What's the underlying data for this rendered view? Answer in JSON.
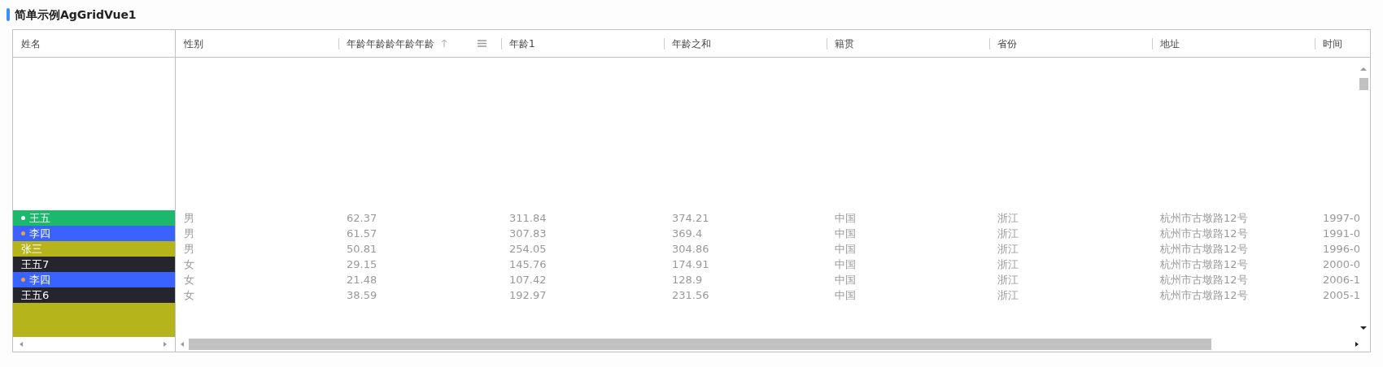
{
  "title": "简单示例AgGridVue1",
  "pinned_column": {
    "label": "姓名"
  },
  "columns": [
    {
      "label": "性别"
    },
    {
      "label": "年龄年龄龄年龄年龄",
      "sorted": true,
      "menu": true
    },
    {
      "label": "年龄1"
    },
    {
      "label": "年龄之和"
    },
    {
      "label": "籍贯"
    },
    {
      "label": "省份"
    },
    {
      "label": "地址"
    },
    {
      "label": "时间"
    }
  ],
  "rows": [
    {
      "name": "王五",
      "color": "#1cb86c",
      "dot": {
        "color": "#ffffff"
      },
      "cells": [
        "男",
        "62.37",
        "311.84",
        "374.21",
        "中国",
        "浙江",
        "杭州市古墩路12号",
        "1997-0"
      ]
    },
    {
      "name": "李四",
      "color": "#3a62fe",
      "dot": {
        "color": "#f0a040"
      },
      "cells": [
        "男",
        "61.57",
        "307.83",
        "369.4",
        "中国",
        "浙江",
        "杭州市古墩路12号",
        "1991-0"
      ]
    },
    {
      "name": "张三",
      "color": "#b5b41a",
      "cells": [
        "男",
        "50.81",
        "254.05",
        "304.86",
        "中国",
        "浙江",
        "杭州市古墩路12号",
        "1996-0"
      ]
    },
    {
      "name": "王五7",
      "color": "#25252d",
      "cells": [
        "女",
        "29.15",
        "145.76",
        "174.91",
        "中国",
        "浙江",
        "杭州市古墩路12号",
        "2000-0"
      ]
    },
    {
      "name": "李四",
      "color": "#3a62fe",
      "dot": {
        "color": "#f0a040"
      },
      "cells": [
        "女",
        "21.48",
        "107.42",
        "128.9",
        "中国",
        "浙江",
        "杭州市古墩路12号",
        "2006-1"
      ]
    },
    {
      "name": "王五6",
      "color": "#25252d",
      "cells": [
        "女",
        "38.59",
        "192.97",
        "231.56",
        "中国",
        "浙江",
        "杭州市古墩路12号",
        "2005-1"
      ]
    }
  ],
  "blurred_rows": [
    {
      "color": "#b5b41a"
    },
    {
      "color": "#b5b41a"
    },
    {
      "color": "#b5b41a"
    }
  ]
}
